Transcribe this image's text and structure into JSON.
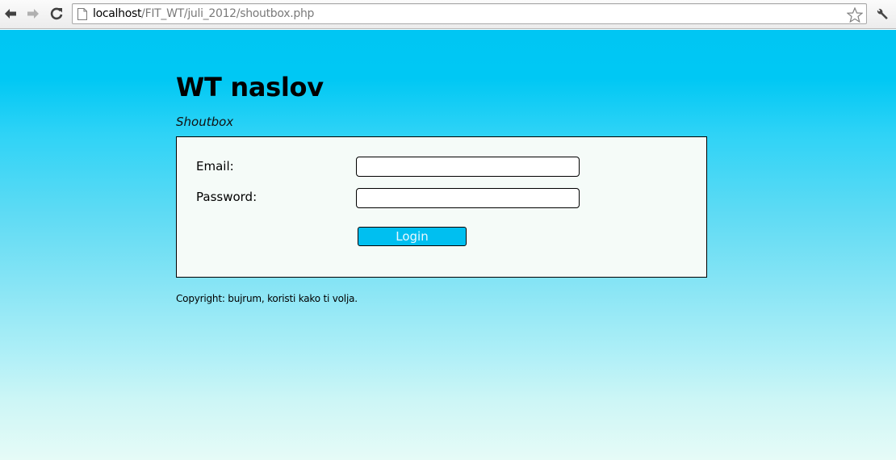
{
  "browser": {
    "url_host": "localhost",
    "url_path": "/FIT_WT/juli_2012/shoutbox.php",
    "icons": {
      "back": "back-arrow-icon",
      "forward": "forward-arrow-icon",
      "reload": "reload-icon",
      "page": "page-icon",
      "bookmark": "star-icon",
      "menu": "wrench-icon"
    }
  },
  "page": {
    "title": "WT naslov",
    "subtitle": "Shoutbox",
    "form": {
      "email_label": "Email:",
      "email_value": "",
      "password_label": "Password:",
      "password_value": "",
      "login_label": "Login"
    },
    "copyright": "Copyright: bujrum, koristi kako ti volja."
  },
  "colors": {
    "gradient_top": "#00c6f3",
    "gradient_bottom": "#e6fbf7",
    "form_background": "#f5fbf8",
    "button": "#00bff0"
  }
}
